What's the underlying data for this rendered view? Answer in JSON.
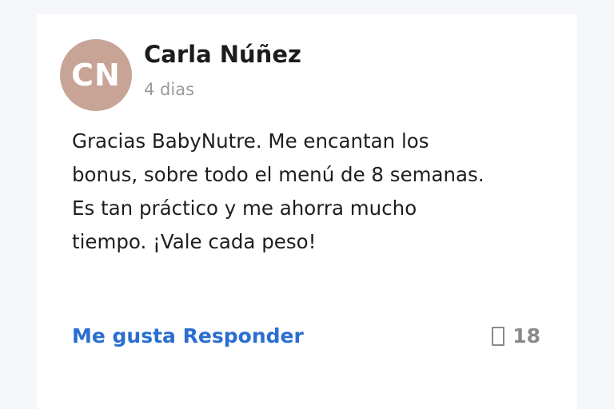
{
  "comment": {
    "avatar_initials": "CN",
    "avatar_color": "#c8a497",
    "author": "Carla Núñez",
    "time": "4 dias",
    "text": "Gracias BabyNutre. Me encantan los bonus, sobre todo el menú de 8 semanas. Es tan práctico y me ahorra mucho tiempo. ¡Vale cada peso!",
    "actions": {
      "like_label": "Me gusta",
      "reply_label": "Responder"
    },
    "reactions": {
      "icon": "thumbs-up-icon",
      "count": "18"
    }
  },
  "colors": {
    "link": "#2a6ed0",
    "muted": "#9a9a9a"
  }
}
